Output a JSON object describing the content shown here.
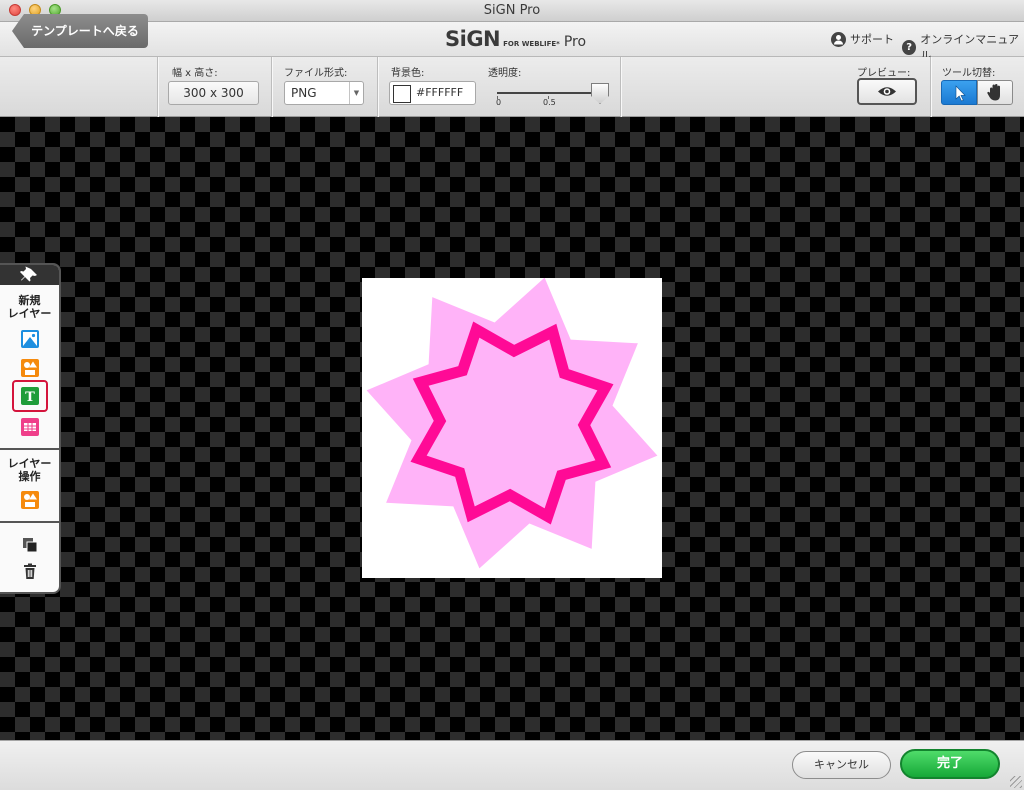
{
  "window": {
    "title": "SiGN Pro"
  },
  "brand": {
    "name": "SiGN",
    "sub": "FOR WEBLIFE*",
    "edition": "Pro"
  },
  "header_links": {
    "support": "サポート",
    "manual": "オンラインマニュアル"
  },
  "toolbar": {
    "back_label": "テンプレートへ戻る",
    "size_label": "幅 x 高さ:",
    "size_value": "300 x 300",
    "format_label": "ファイル形式:",
    "format_value": "PNG",
    "bg_label": "背景色:",
    "bg_value": "#FFFFFF",
    "opacity_label": "透明度:",
    "opacity_min": "0",
    "opacity_mid": "0.5",
    "opacity_value": 1.0,
    "preview_label": "プレビュー:",
    "tool_label": "ツール切替:"
  },
  "left_panel": {
    "new_layer_title": "新規\nレイヤー",
    "layer_ops_title": "レイヤー\n操作",
    "text_icon_glyph": "T"
  },
  "canvas": {
    "width": 300,
    "height": 300,
    "background": "#FFFFFF",
    "star_outer_color": "#FFB3F8",
    "star_inner_color": "#FFB3F8",
    "star_stroke_color": "#FF0A96"
  },
  "footer": {
    "cancel_label": "キャンセル",
    "done_label": "完了"
  },
  "colors": {
    "accent_blue": "#1b79d2",
    "done_green": "#16a838",
    "highlight_red": "#d4143c"
  }
}
